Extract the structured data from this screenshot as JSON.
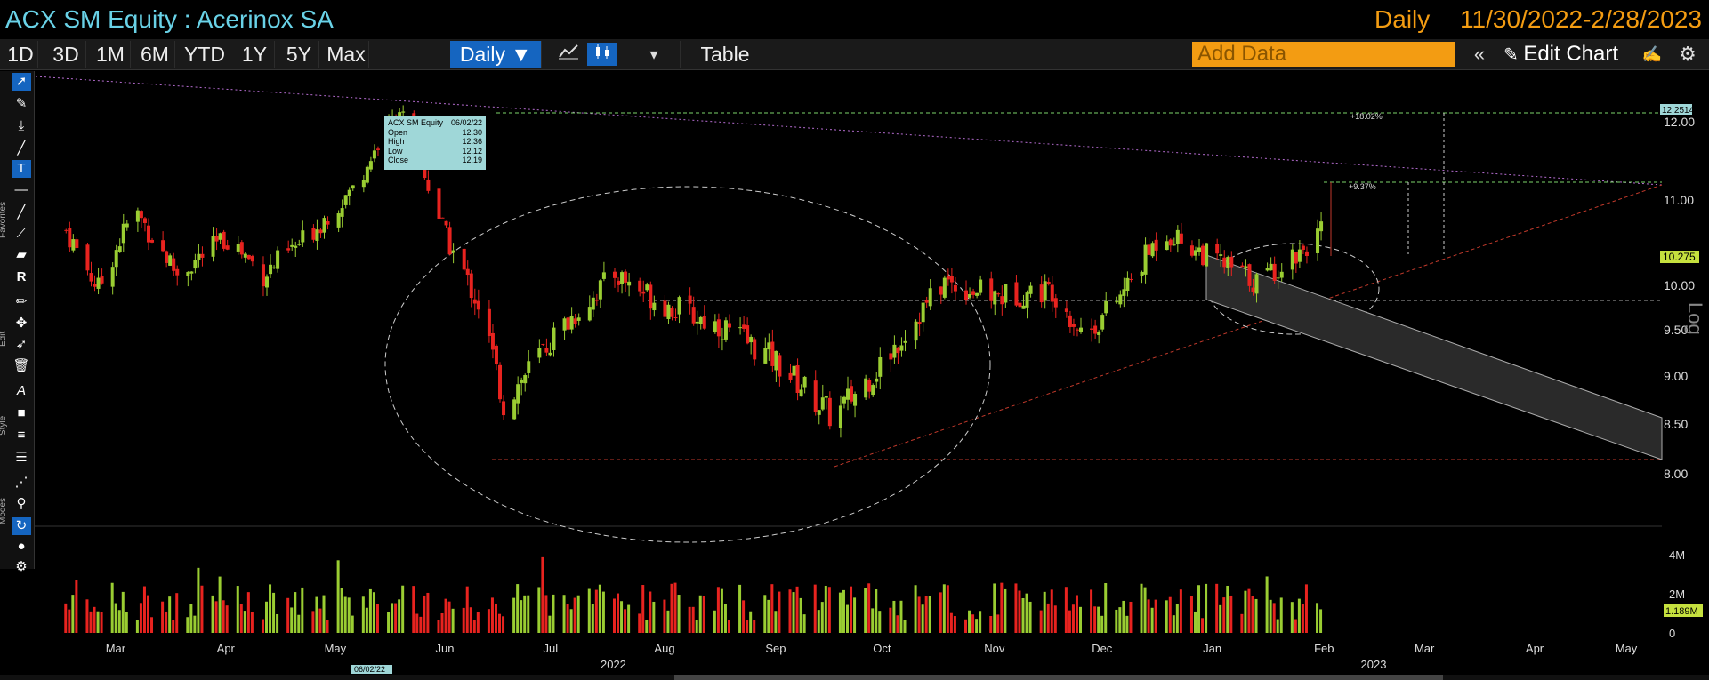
{
  "title": {
    "security": "ACX SM Equity : Acerinox SA",
    "frequency": "Daily",
    "date_range": "11/30/2022-2/28/2023"
  },
  "toolbar": {
    "periods": [
      "1D",
      "3D",
      "1M",
      "6M",
      "YTD",
      "1Y",
      "5Y",
      "Max"
    ],
    "frequency_button": "Daily ▼",
    "table_label": "Table",
    "add_data_placeholder": "Add Data",
    "edit_chart_label": "Edit Chart"
  },
  "sidebar": {
    "section_labels": [
      "Favorites",
      "Edit",
      "Style",
      "Modes"
    ],
    "tools": [
      "cursor-icon",
      "pen-icon",
      "measure-icon",
      "line-icon",
      "text-cursor-icon",
      "hline-icon",
      "brush-icon",
      "trend-icon",
      "channel-icon",
      "R-icon",
      "pencil-icon",
      "move-icon",
      "pointer-icon",
      "trash-icon",
      "font-icon",
      "fill-icon",
      "line-style-icon",
      "line-weight-icon",
      "pattern-icon",
      "magic-icon",
      "cycle-icon",
      "color-icon",
      "gear-icon"
    ]
  },
  "tooltip": {
    "security": "ACX SM Equity",
    "date": "06/02/22",
    "rows": [
      {
        "label": "Open",
        "value": "12.30"
      },
      {
        "label": "High",
        "value": "12.36"
      },
      {
        "label": "Low",
        "value": "12.12"
      },
      {
        "label": "Close",
        "value": "12.19"
      }
    ]
  },
  "annotations": {
    "pct_upper": "+18.02%",
    "pct_lower": "+9.37%",
    "log_label": "Log"
  },
  "price_axis": {
    "ticks": [
      "12.00",
      "11.00",
      "10.00",
      "9.50",
      "9.00",
      "8.50",
      "8.00"
    ],
    "tag_high": "12.2514",
    "tag_last": "10.275"
  },
  "volume_axis": {
    "ticks": [
      "4M",
      "2M",
      "0"
    ],
    "tag_last": "1.189M"
  },
  "time_axis": {
    "months": [
      "Mar",
      "Apr",
      "May",
      "Jun",
      "Jul",
      "Aug",
      "Sep",
      "Oct",
      "Nov",
      "Dec",
      "Jan",
      "Feb",
      "Mar",
      "Apr",
      "May"
    ],
    "years": [
      "2022",
      "2023"
    ],
    "cursor_date": "06/02/22"
  },
  "colors": {
    "up": "#9acd32",
    "down": "#e8231f",
    "title": "#69d2e7",
    "accent": "#f39c12",
    "active": "#1565c0"
  },
  "chart_data": {
    "type": "candlestick",
    "title": "ACX SM Equity : Acerinox SA",
    "scale": "log",
    "ylim": [
      7.5,
      12.4
    ],
    "price_path": [
      {
        "date": "2022-03-01",
        "close": 10.3
      },
      {
        "date": "2022-03-10",
        "close": 9.5
      },
      {
        "date": "2022-03-20",
        "close": 10.6
      },
      {
        "date": "2022-04-01",
        "close": 9.7
      },
      {
        "date": "2022-04-15",
        "close": 10.2
      },
      {
        "date": "2022-04-25",
        "close": 9.7
      },
      {
        "date": "2022-05-05",
        "close": 10.1
      },
      {
        "date": "2022-05-20",
        "close": 10.9
      },
      {
        "date": "2022-06-02",
        "close": 12.19
      },
      {
        "date": "2022-06-15",
        "close": 10.2
      },
      {
        "date": "2022-06-25",
        "close": 9.2
      },
      {
        "date": "2022-07-01",
        "close": 8.1
      },
      {
        "date": "2022-07-15",
        "close": 8.9
      },
      {
        "date": "2022-08-01",
        "close": 9.7
      },
      {
        "date": "2022-08-15",
        "close": 9.3
      },
      {
        "date": "2022-09-01",
        "close": 9.0
      },
      {
        "date": "2022-09-15",
        "close": 8.6
      },
      {
        "date": "2022-10-01",
        "close": 7.95
      },
      {
        "date": "2022-10-15",
        "close": 8.6
      },
      {
        "date": "2022-11-01",
        "close": 9.6
      },
      {
        "date": "2022-11-15",
        "close": 9.4
      },
      {
        "date": "2022-12-01",
        "close": 9.5
      },
      {
        "date": "2022-12-10",
        "close": 8.9
      },
      {
        "date": "2022-12-20",
        "close": 9.4
      },
      {
        "date": "2023-01-01",
        "close": 10.3
      },
      {
        "date": "2023-01-15",
        "close": 9.9
      },
      {
        "date": "2023-01-27",
        "close": 9.6
      },
      {
        "date": "2023-02-05",
        "close": 9.9
      },
      {
        "date": "2023-02-14",
        "close": 10.275
      }
    ],
    "last_price": 10.275,
    "period_high": 12.2514,
    "last_volume": "1.189M"
  }
}
